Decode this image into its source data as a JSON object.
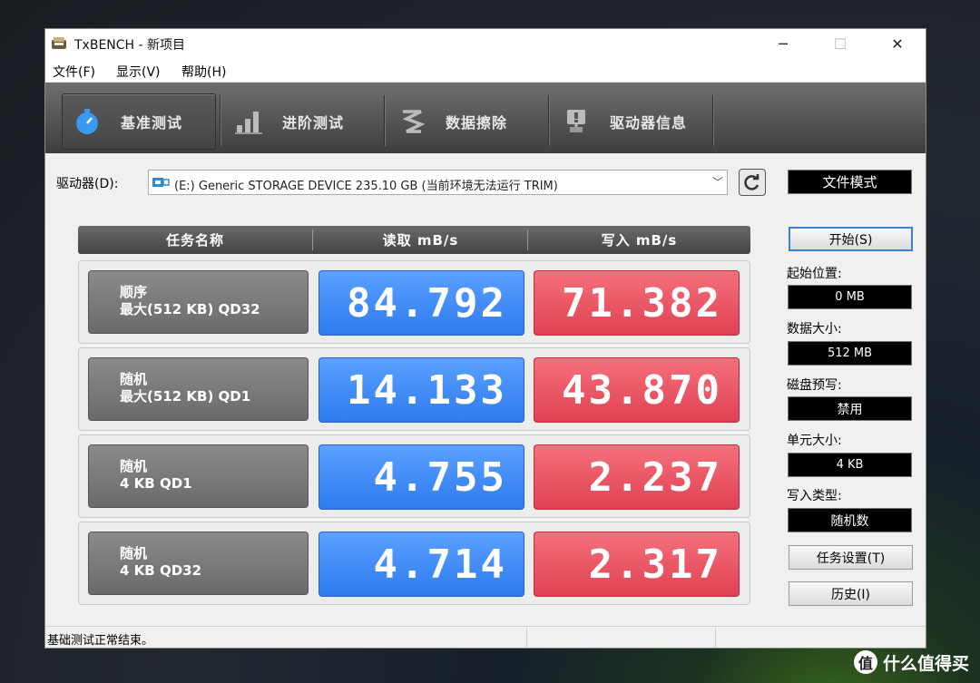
{
  "window": {
    "title": "TxBENCH - 新项目",
    "min": "─",
    "max": "☐",
    "close": "✕"
  },
  "menu": [
    "文件(F)",
    "显示(V)",
    "帮助(H)"
  ],
  "tabs": [
    {
      "label": "基准测试",
      "icon": "stopwatch-icon"
    },
    {
      "label": "进阶测试",
      "icon": "bar-chart-icon"
    },
    {
      "label": "数据擦除",
      "icon": "eraser-icon"
    },
    {
      "label": "驱动器信息",
      "icon": "drive-info-icon"
    }
  ],
  "drive": {
    "label": "驱动器(D):",
    "value": "(E:) Generic STORAGE DEVICE  235.10 GB (当前环境无法运行 TRIM)",
    "chevron": "﹀"
  },
  "mode": "文件模式",
  "table": {
    "headers": [
      "任务名称",
      "读取 mB/s",
      "写入 mB/s"
    ],
    "rows": [
      {
        "line1": "顺序",
        "line2": "最大(512 KB) QD32",
        "read": "84.792",
        "write": "71.382"
      },
      {
        "line1": "随机",
        "line2": "最大(512 KB) QD1",
        "read": "14.133",
        "write": "43.870"
      },
      {
        "line1": "随机",
        "line2": "4 KB QD1",
        "read": "4.755",
        "write": "2.237"
      },
      {
        "line1": "随机",
        "line2": "4 KB QD32",
        "read": "4.714",
        "write": "2.317"
      }
    ]
  },
  "side": {
    "start": "开始(S)",
    "start_pos_label": "起始位置:",
    "start_pos": "0 MB",
    "data_size_label": "数据大小:",
    "data_size": "512 MB",
    "cache_label": "磁盘预写:",
    "cache": "禁用",
    "unit_label": "单元大小:",
    "unit": "4 KB",
    "write_type_label": "写入类型:",
    "write_type": "随机数",
    "task_settings": "任务设置(T)",
    "history": "历史(I)"
  },
  "status": "基础测试正常结束。",
  "watermark": "什么值得买",
  "watermark_logo": "值",
  "colors": {
    "read": "#3a86f6",
    "write": "#e9525f",
    "toolbar": "#555555"
  }
}
